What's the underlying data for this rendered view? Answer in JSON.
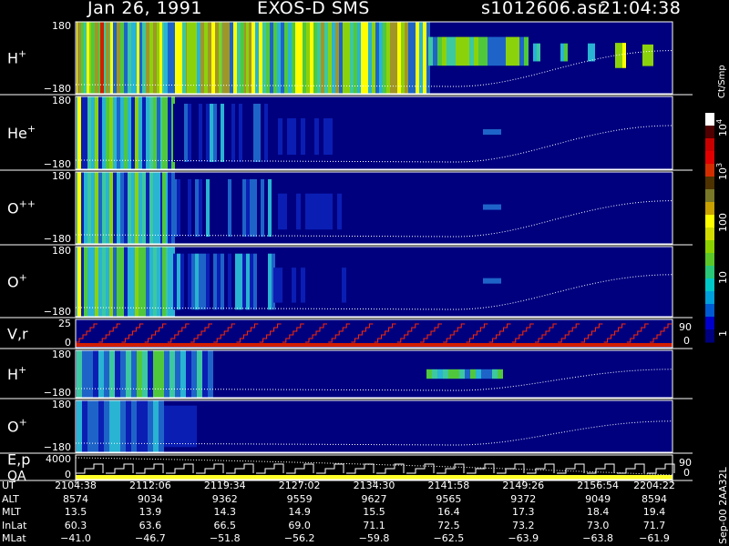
{
  "header": {
    "date": "Jan 26, 1991",
    "instrument": "EXOS-D SMS",
    "file": "s1012606.asr",
    "time": "21:04:38"
  },
  "colorbar": {
    "unit": "Ct/Smp",
    "ticks": [
      "10",
      "100",
      "1",
      "10",
      "1"
    ],
    "tick_10": "10",
    "tick_100": "100",
    "tick_1": "1",
    "tick_1e3": "10",
    "tick_1e3_exp": "3",
    "tick_1e4": "10",
    "tick_1e4_exp": "4",
    "colors": [
      "#00007f",
      "#0000c8",
      "#005ad2",
      "#00a0dc",
      "#00c8c8",
      "#28c878",
      "#5ac828",
      "#8cd200",
      "#d2dc00",
      "#ffff00",
      "#c8a000",
      "#787828",
      "#4e3200",
      "#d22d00",
      "#e10000",
      "#c80000",
      "#500000",
      "#ffffff"
    ]
  },
  "panels": [
    {
      "label": "H",
      "sup": "+",
      "ymax": "180",
      "ymin": "−180"
    },
    {
      "label": "He",
      "sup": "+",
      "ymax": "180",
      "ymin": "−180"
    },
    {
      "label": "O",
      "sup": "++",
      "ymax": "180",
      "ymin": "−180"
    },
    {
      "label": "O",
      "sup": "+",
      "ymax": "180",
      "ymin": "−180"
    },
    {
      "label": "V,r",
      "sup": "",
      "ymax": "25",
      "ymin": "0",
      "right": "90",
      "right2": "0"
    },
    {
      "label": "H",
      "sup": "+",
      "ymax": "180",
      "ymin": "−180"
    },
    {
      "label": "O",
      "sup": "+",
      "ymax": "180",
      "ymin": "−180"
    },
    {
      "label": "E,p",
      "label2": "QA",
      "sup": "",
      "ymax": "4000",
      "ymin": "0",
      "right": "90",
      "right2": "0"
    }
  ],
  "footer": {
    "rows": [
      {
        "label": "UT",
        "values": [
          "2104:38",
          "2112:06",
          "2119:34",
          "2127:02",
          "2134:30",
          "2141:58",
          "2149:26",
          "2156:54",
          "2204:22"
        ]
      },
      {
        "label": "ALT",
        "values": [
          "8574",
          "9034",
          "9362",
          "9559",
          "9627",
          "9565",
          "9372",
          "9049",
          "8594"
        ]
      },
      {
        "label": "MLT",
        "values": [
          "13.5",
          "13.9",
          "14.3",
          "14.9",
          "15.5",
          "16.4",
          "17.3",
          "18.4",
          "19.4"
        ]
      },
      {
        "label": "InLat",
        "values": [
          "60.3",
          "63.6",
          "66.5",
          "69.0",
          "71.1",
          "72.5",
          "73.2",
          "73.0",
          "71.7"
        ]
      },
      {
        "label": "MLat",
        "values": [
          "−41.0",
          "−46.7",
          "−51.8",
          "−56.2",
          "−59.8",
          "−62.5",
          "−63.9",
          "−63.8",
          "−61.9"
        ]
      }
    ],
    "side": "Sep-00 2AA32L"
  },
  "chart_data": {
    "type": "heatmap",
    "title": "Jan 26, 1991   EXOS-D SMS",
    "x": [
      "2104:38",
      "2112:06",
      "2119:34",
      "2127:02",
      "2134:30",
      "2141:58",
      "2149:26",
      "2156:54",
      "2204:22"
    ],
    "xlabel": "UT",
    "series": [
      {
        "name": "H+",
        "ylim": [
          -180,
          180
        ]
      },
      {
        "name": "He+",
        "ylim": [
          -180,
          180
        ]
      },
      {
        "name": "O++",
        "ylim": [
          -180,
          180
        ]
      },
      {
        "name": "O+",
        "ylim": [
          -180,
          180
        ]
      },
      {
        "name": "V,r",
        "ylim": [
          0,
          25
        ]
      },
      {
        "name": "H+",
        "ylim": [
          -180,
          180
        ]
      },
      {
        "name": "O+",
        "ylim": [
          -180,
          180
        ]
      },
      {
        "name": "E,p",
        "ylim": [
          0,
          4000
        ]
      }
    ],
    "colorbar_ticks": [
      "1",
      "10",
      "100",
      "10^3",
      "10^4"
    ],
    "colorbar_unit": "Ct/Smp",
    "right_axis_ticks": [
      "90",
      "0"
    ],
    "grid": false
  }
}
